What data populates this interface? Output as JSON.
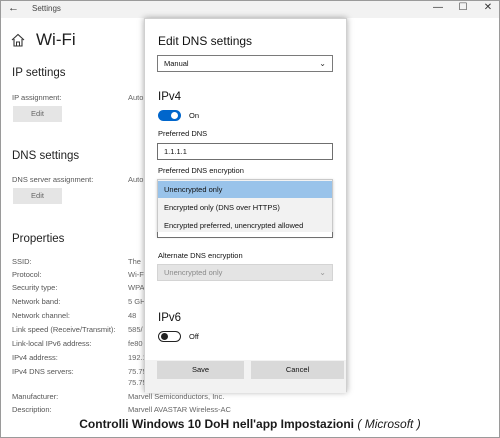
{
  "window": {
    "back_glyph": "←",
    "title": "Settings",
    "minimize_glyph": "—",
    "maximize_glyph": "☐",
    "close_glyph": "✕"
  },
  "page": {
    "title": "Wi-Fi",
    "home_icon": "home-icon"
  },
  "ip_settings": {
    "heading": "IP settings",
    "assignment_label": "IP assignment:",
    "assignment_value": "Auto",
    "edit_label": "Edit"
  },
  "dns_settings": {
    "heading": "DNS settings",
    "assignment_label": "DNS server assignment:",
    "assignment_value": "Auto",
    "edit_label": "Edit"
  },
  "properties": {
    "heading": "Properties",
    "rows": [
      {
        "label": "SSID:",
        "value": "The"
      },
      {
        "label": "Protocol:",
        "value": "Wi-F"
      },
      {
        "label": "Security type:",
        "value": "WPA"
      },
      {
        "label": "Network band:",
        "value": "5 GH"
      },
      {
        "label": "Network channel:",
        "value": "48"
      },
      {
        "label": "Link speed (Receive/Transmit):",
        "value": "585/"
      },
      {
        "label": "Link-local IPv6 address:",
        "value": "fe80"
      },
      {
        "label": "IPv4 address:",
        "value": "192.1"
      },
      {
        "label": "IPv4 DNS servers:",
        "value": "75.75"
      },
      {
        "label": "",
        "value": "75.75"
      },
      {
        "label": "Manufacturer:",
        "value": "Marvell Semiconductors, Inc."
      },
      {
        "label": "Description:",
        "value": "Marvell AVASTAR Wireless-AC"
      }
    ]
  },
  "dialog": {
    "title": "Edit DNS settings",
    "mode_select": "Manual",
    "ipv4": {
      "heading": "IPv4",
      "toggle_state": "On",
      "preferred_label": "Preferred DNS",
      "preferred_value": "1.1.1.1",
      "encryption_label": "Preferred DNS encryption",
      "encryption_options": [
        "Unencrypted only",
        "Encrypted only (DNS over HTTPS)",
        "Encrypted preferred, unencrypted allowed"
      ],
      "encryption_selected_index": 0,
      "alternate_enc_label": "Alternate DNS encryption",
      "alternate_enc_value": "Unencrypted only"
    },
    "ipv6": {
      "heading": "IPv6",
      "toggle_state": "Off"
    },
    "save_label": "Save",
    "cancel_label": "Cancel"
  },
  "caption": {
    "text": "Controlli Windows 10 DoH nell'app Impostazioni",
    "open_paren": " ( ",
    "source": "Microsoft",
    "close_paren": " )"
  },
  "colors": {
    "accent": "#0066cc",
    "dropdown_highlight": "#99c3ea",
    "button_row": "#f2f2f2"
  }
}
